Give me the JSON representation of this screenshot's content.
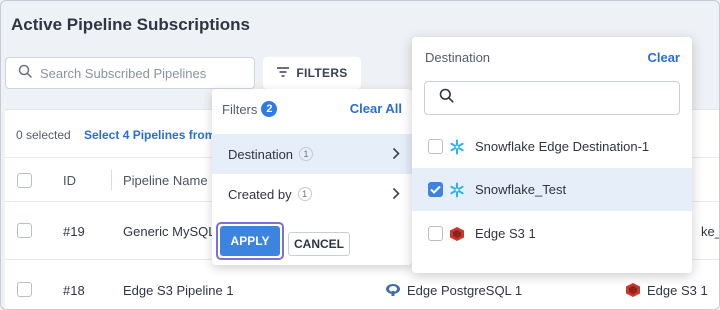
{
  "page": {
    "title": "Active Pipeline Subscriptions"
  },
  "search": {
    "placeholder": "Search Subscribed Pipelines"
  },
  "toolbar": {
    "filters_label": "FILTERS"
  },
  "selection": {
    "count_text": "0 selected",
    "select_link": "Select 4 Pipelines from"
  },
  "table": {
    "headers": [
      "ID",
      "Pipeline Name"
    ],
    "rows": [
      {
        "id": "#19",
        "name": "Generic MySQL",
        "source": "",
        "destination": "ke_Te"
      },
      {
        "id": "#18",
        "name": "Edge S3 Pipeline 1",
        "source": "Edge PostgreSQL 1",
        "destination": "Edge S3 1"
      }
    ]
  },
  "filters_panel": {
    "title": "Filters",
    "active_count": "2",
    "clear_label": "Clear All",
    "items": [
      {
        "label": "Destination",
        "count": "1"
      },
      {
        "label": "Created by",
        "count": "1"
      }
    ],
    "apply_label": "APPLY",
    "cancel_label": "CANCEL"
  },
  "destination_panel": {
    "title": "Destination",
    "clear_label": "Clear",
    "options": [
      {
        "label": "Snowflake Edge Destination-1",
        "checked": false,
        "icon": "snowflake-icon"
      },
      {
        "label": "Snowflake_Test",
        "checked": true,
        "icon": "snowflake-icon"
      },
      {
        "label": "Edge S3 1",
        "checked": false,
        "icon": "s3-icon"
      }
    ]
  },
  "colors": {
    "accent": "#3d84e0",
    "link": "#2a6dd1",
    "highlight": "#e6eefa",
    "focus_ring": "#7d6ee0"
  }
}
